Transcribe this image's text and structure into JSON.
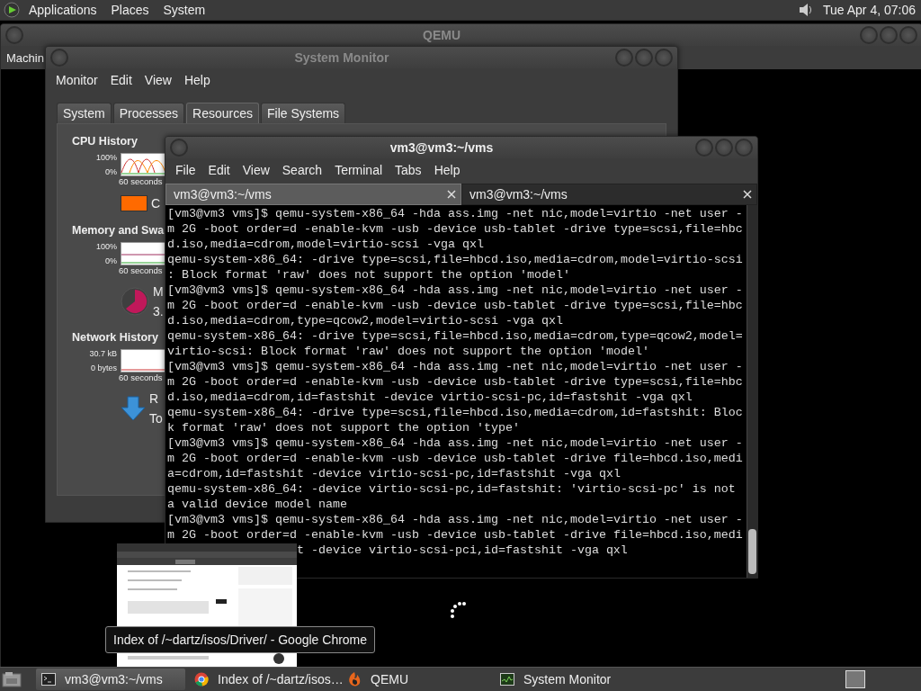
{
  "top_panel": {
    "menus": [
      "Applications",
      "Places",
      "System"
    ],
    "clock": "Tue Apr 4, 07:06"
  },
  "qemu_window": {
    "title": "QEMU",
    "menus": [
      "Machin"
    ]
  },
  "system_monitor": {
    "title": "System Monitor",
    "menus": [
      "Monitor",
      "Edit",
      "View",
      "Help"
    ],
    "tabs": [
      {
        "label": "System",
        "selected": false
      },
      {
        "label": "Processes",
        "selected": false
      },
      {
        "label": "Resources",
        "selected": true
      },
      {
        "label": "File Systems",
        "selected": false
      }
    ],
    "sections": [
      {
        "kind": "cpu",
        "title": "CPU History",
        "y_max": "100%",
        "y_min": "0%",
        "x_span": "60 seconds",
        "legend": [
          "C"
        ]
      },
      {
        "kind": "memory",
        "title": "Memory and Swa",
        "y_max": "100%",
        "y_min": "0%",
        "x_span": "60 seconds",
        "legend": [
          "M",
          "3."
        ]
      },
      {
        "kind": "network",
        "title": "Network History",
        "y_max": "30.7 kB",
        "y_min": "0 bytes",
        "x_span": "60 seconds",
        "legend": [
          "R",
          "To"
        ]
      }
    ]
  },
  "terminal": {
    "title": "vm3@vm3:~/vms",
    "menus": [
      "File",
      "Edit",
      "View",
      "Search",
      "Terminal",
      "Tabs",
      "Help"
    ],
    "tabs": [
      {
        "label": "vm3@vm3:~/vms",
        "selected": true
      },
      {
        "label": "vm3@vm3:~/vms",
        "selected": false
      }
    ],
    "lines": [
      "[vm3@vm3 vms]$ qemu-system-x86_64 -hda ass.img -net nic,model=virtio -net user -",
      "m 2G -boot order=d -enable-kvm -usb -device usb-tablet -drive type=scsi,file=hbc",
      "d.iso,media=cdrom,model=virtio-scsi -vga qxl",
      "qemu-system-x86_64: -drive type=scsi,file=hbcd.iso,media=cdrom,model=virtio-scsi",
      ": Block format 'raw' does not support the option 'model'",
      "[vm3@vm3 vms]$ qemu-system-x86_64 -hda ass.img -net nic,model=virtio -net user -",
      "m 2G -boot order=d -enable-kvm -usb -device usb-tablet -drive type=scsi,file=hbc",
      "d.iso,media=cdrom,type=qcow2,model=virtio-scsi -vga qxl",
      "qemu-system-x86_64: -drive type=scsi,file=hbcd.iso,media=cdrom,type=qcow2,model=",
      "virtio-scsi: Block format 'raw' does not support the option 'model'",
      "[vm3@vm3 vms]$ qemu-system-x86_64 -hda ass.img -net nic,model=virtio -net user -",
      "m 2G -boot order=d -enable-kvm -usb -device usb-tablet -drive type=scsi,file=hbc",
      "d.iso,media=cdrom,id=fastshit -device virtio-scsi-pc,id=fastshit -vga qxl",
      "qemu-system-x86_64: -drive type=scsi,file=hbcd.iso,media=cdrom,id=fastshit: Bloc",
      "k format 'raw' does not support the option 'type'",
      "[vm3@vm3 vms]$ qemu-system-x86_64 -hda ass.img -net nic,model=virtio -net user -",
      "m 2G -boot order=d -enable-kvm -usb -device usb-tablet -drive file=hbcd.iso,medi",
      "a=cdrom,id=fastshit -device virtio-scsi-pc,id=fastshit -vga qxl",
      "qemu-system-x86_64: -device virtio-scsi-pc,id=fastshit: 'virtio-scsi-pc' is not",
      "a valid device model name",
      "[vm3@vm3 vms]$ qemu-system-x86_64 -hda ass.img -net nic,model=virtio -net user -",
      "m 2G -boot order=d -enable-kvm -usb -device usb-tablet -drive file=hbcd.iso,medi"
    ],
    "partly_hidden_line": "t -device virtio-scsi-pci,id=fastshit -vga qxl"
  },
  "window_preview": {
    "kind": "picture",
    "tooltip": "Index of /~dartz/isos/Driver/ - Google Chrome"
  },
  "taskbar": {
    "tasks": [
      {
        "label": "vm3@vm3:~/vms",
        "kind": "terminal",
        "selected": true
      },
      {
        "label": "Index of /~dartz/isos…",
        "kind": "browser",
        "selected": false
      },
      {
        "label": "QEMU",
        "kind": "qemu",
        "selected": false
      },
      {
        "label": "System Monitor",
        "kind": "monitor",
        "selected": false
      }
    ]
  }
}
